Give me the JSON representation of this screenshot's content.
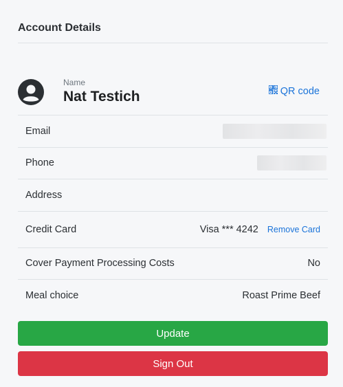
{
  "header": {
    "title": "Account Details"
  },
  "profile": {
    "name_label": "Name",
    "name": "Nat Testich",
    "qr_link": "QR code"
  },
  "rows": [
    {
      "label": "Email",
      "value": ""
    },
    {
      "label": "Phone",
      "value": ""
    },
    {
      "label": "Address",
      "value": ""
    },
    {
      "label": "Credit Card",
      "value": "Visa *** 4242",
      "action": "Remove Card"
    },
    {
      "label": "Cover Payment Processing Costs",
      "value": "No"
    },
    {
      "label": "Meal choice",
      "value": "Roast Prime Beef"
    }
  ],
  "buttons": {
    "update": "Update",
    "sign_out": "Sign Out"
  },
  "colors": {
    "link": "#1a73d9",
    "update": "#28a745",
    "sign_out": "#dc3545"
  },
  "icons": {
    "avatar": "user-circle-icon",
    "qr": "qr-code-icon"
  }
}
